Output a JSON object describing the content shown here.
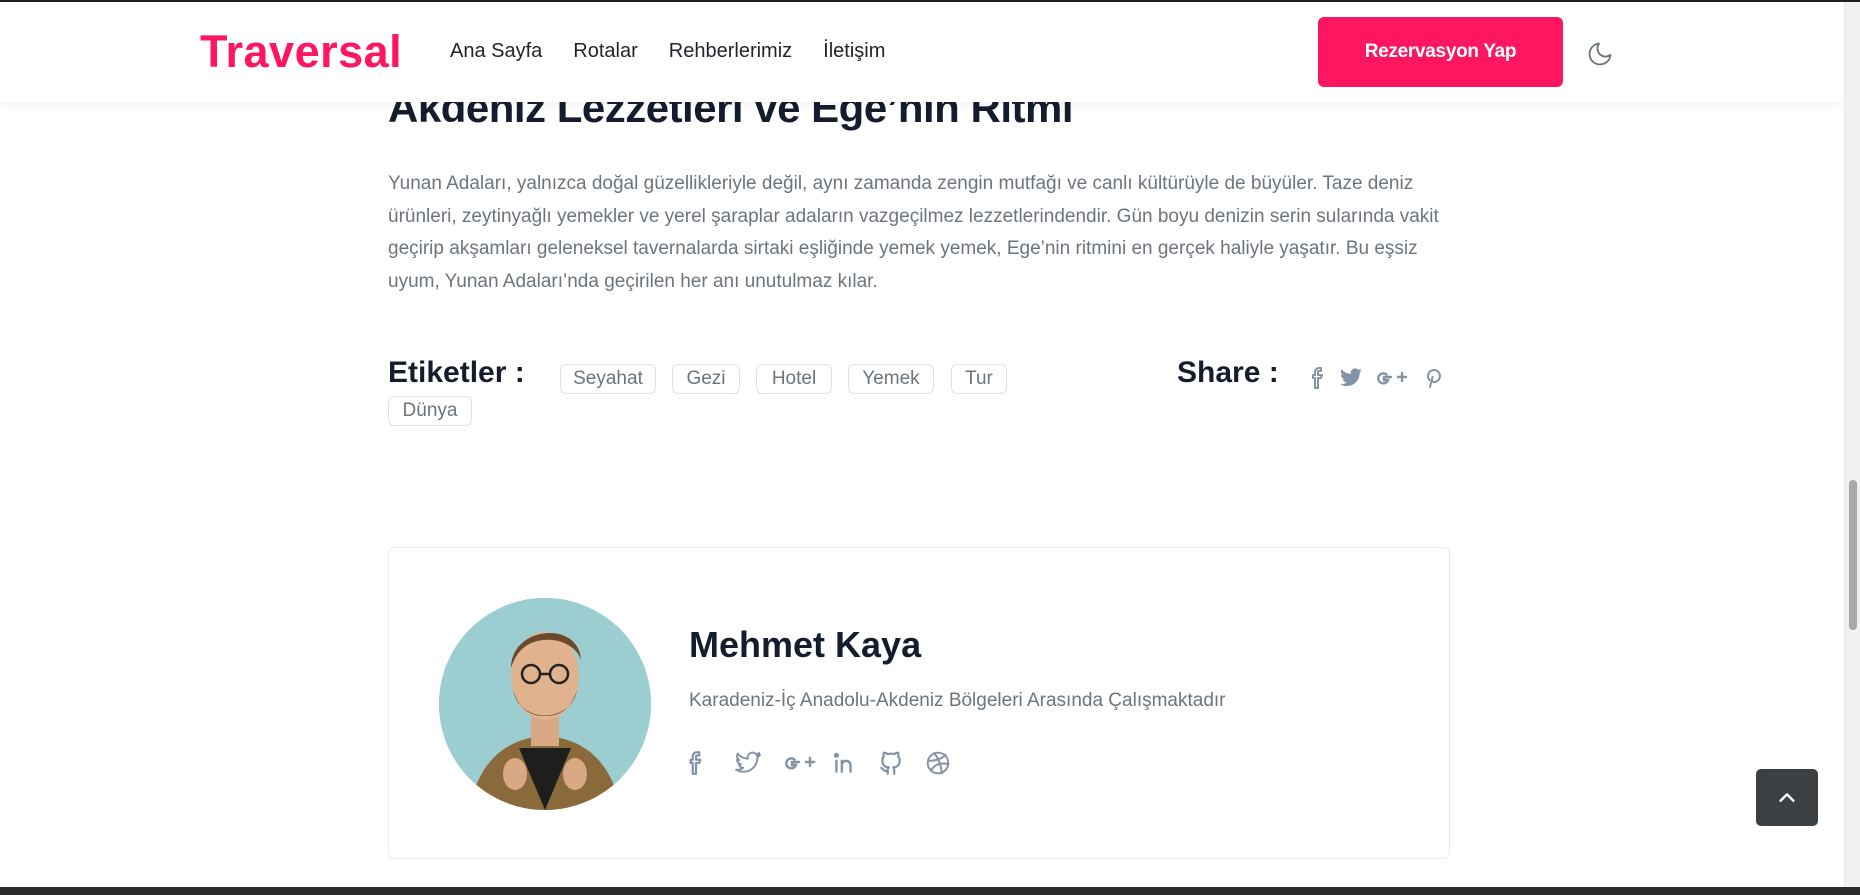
{
  "colors": {
    "accent": "#ff1661",
    "heading": "#161c2d",
    "muted": "#6c757d",
    "icon": "#8492a6"
  },
  "navbar": {
    "brand": "Traversal",
    "links": [
      "Ana Sayfa",
      "Rotalar",
      "Rehberlerimiz",
      "İletişim"
    ],
    "cta_label": "Rezervasyon Yap",
    "theme_toggle_icon": "moon-icon"
  },
  "article": {
    "title": "Akdeniz Lezzetleri ve Ege’nin Ritmi",
    "body": "Yunan Adaları, yalnızca doğal güzellikleriyle değil, aynı zamanda zengin mutfağı ve canlı kültürüyle de büyüler. Taze deniz ürünleri, zeytinyağlı yemekler ve yerel şaraplar adaların vazgeçilmez lezzetlerindendir. Gün boyu denizin serin sularında vakit geçirip akşamları geleneksel tavernalarda sirtaki eşliğinde yemek yemek, Ege’nin ritmini en gerçek haliyle yaşatır. Bu eşsiz uyum, Yunan Adaları’nda geçirilen her anı unutulmaz kılar."
  },
  "tags": {
    "label": "Etiketler :",
    "items": [
      "Seyahat",
      "Gezi",
      "Hotel",
      "Yemek",
      "Tur",
      "Dünya"
    ]
  },
  "share": {
    "label": "Share :",
    "icons": [
      "facebook-icon",
      "twitter-icon",
      "google-plus-icon",
      "pinterest-icon"
    ]
  },
  "author": {
    "name": "Mehmet Kaya",
    "description": "Karadeniz-İç Anadolu-Akdeniz Bölgeleri Arasında Çalışmaktadır",
    "social_icons": [
      "facebook-icon",
      "twitter-icon",
      "google-plus-icon",
      "linkedin-icon",
      "github-icon",
      "dribbble-icon"
    ]
  },
  "back_to_top_icon": "chevron-up-icon"
}
